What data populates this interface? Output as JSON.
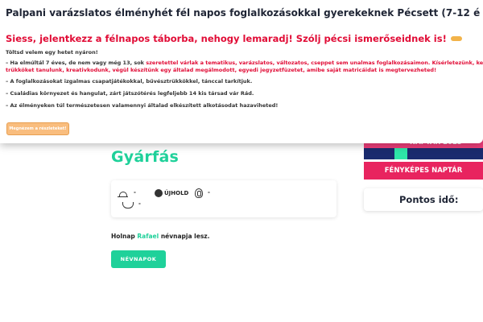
{
  "popup": {
    "title": "Palpani varázslatos élményhét fél napos foglalkozásokkal gyerekeknek Pécsett (7-12 é",
    "headline": "Siess, jelentkezz a félnapos táborba, nehogy lemaradj! Szólj pécsi ismerőseidnek is!",
    "headline_icon": "pointing-hand-icon",
    "subheading": "Töltsd velem egy hetet nyáron!",
    "bullet1_prefix": "– Ha elmúltál 7 éves, de nem vagy még 13, sok ",
    "bullet1_red": "szeretettel várlak a tematikus, varázslatos, változatos, cseppet sem unalmas foglalkozásaimon. Kísérletezünk, kencsz",
    "bullet1_red_line2": "trükköket tanulunk, kreativkodunk, végül készítünk egy általad megálmodott, egyedi jegyzetfüzetet, amibe saját matricáidat is megtervezheted!",
    "bullet2": "– A foglalkozásokat izgalmas csapatjátékokkal, bűvésztrükkökkel, tánccal tarkítjuk.",
    "bullet3": "– Családias környezet és hangulat, zárt játszótérés legfeljebb 14 kis társad vár Rád.",
    "bullet4": "– Az élményeken túl természetesen valamennyi általad elkészített alkotásodat hazaviheted!",
    "more_button": "Megnézem a részleteket!"
  },
  "main": {
    "name": "Gyárfás",
    "weather": {
      "sun_icon": "sunrise-icon",
      "sun_value": "-",
      "wave_icon": "water-icon",
      "wave_value": "-",
      "moon_icon": "moon-icon",
      "moon_label": "ÚJHOLD",
      "fp_icon": "fingerprint-icon",
      "fp_value": "-"
    },
    "nameday_prefix": "Holnap ",
    "nameday_name": "Rafael",
    "nameday_suffix": " névnapja lesz.",
    "nevnapok_button": "NÉVNAPOK"
  },
  "sidebar": {
    "calendar_banner_text": "NAPTÁR 2023",
    "photo_calendar_button": "FÉNYKÉPES NAPTÁR",
    "exact_time_title": "Pontos idő:"
  },
  "colors": {
    "accent_green": "#1fd19a",
    "alert_red": "#e10c36",
    "brand_pink": "#e8245f",
    "navy": "#1a2b6e",
    "button_orange": "#f9bd7e"
  }
}
